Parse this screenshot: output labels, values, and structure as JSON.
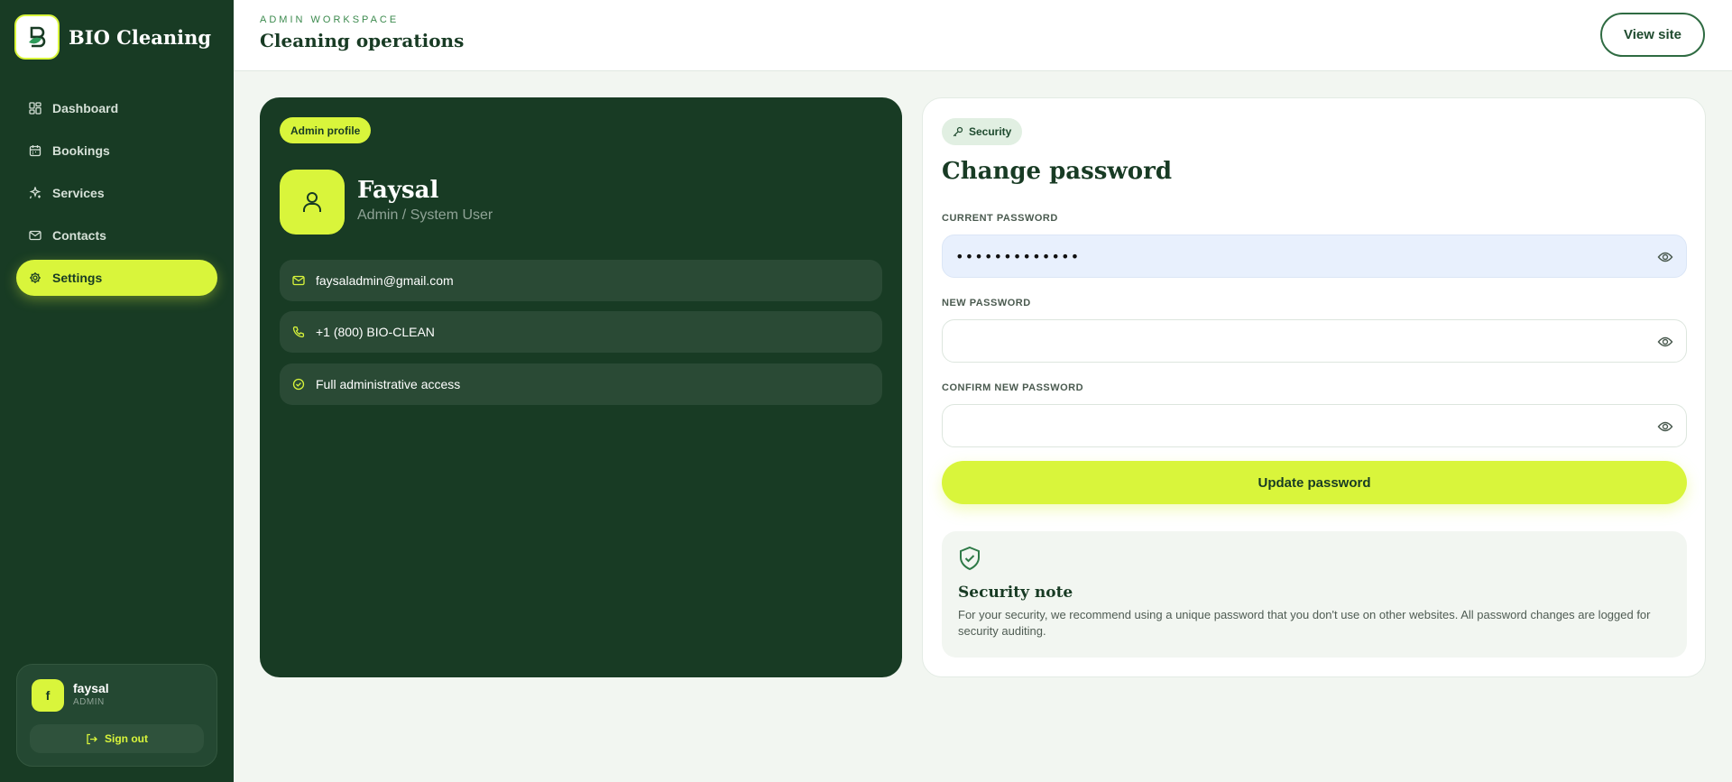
{
  "brand": {
    "name": "BIO Cleaning"
  },
  "sidebar": {
    "items": [
      {
        "label": "Dashboard",
        "icon": "dashboard-icon"
      },
      {
        "label": "Bookings",
        "icon": "calendar-icon"
      },
      {
        "label": "Services",
        "icon": "sparkles-icon"
      },
      {
        "label": "Contacts",
        "icon": "mail-icon"
      },
      {
        "label": "Settings",
        "icon": "gear-icon",
        "active": true
      }
    ],
    "user": {
      "initial": "f",
      "name": "faysal",
      "role": "ADMIN",
      "signout_label": "Sign out"
    }
  },
  "header": {
    "eyebrow": "ADMIN WORKSPACE",
    "title": "Cleaning operations",
    "view_site_label": "View site"
  },
  "profile": {
    "chip": "Admin profile",
    "name": "Faysal",
    "role": "Admin / System User",
    "email": "faysaladmin@gmail.com",
    "phone": "+1 (800) BIO-CLEAN",
    "access": "Full administrative access"
  },
  "security": {
    "chip": "Security",
    "title": "Change password",
    "current_label": "CURRENT PASSWORD",
    "current_value": "•••••••••••••",
    "new_label": "NEW PASSWORD",
    "new_value": "",
    "confirm_label": "CONFIRM NEW PASSWORD",
    "confirm_value": "",
    "button_label": "Update password",
    "note_title": "Security note",
    "note_text": "For your security, we recommend using a unique password that you don't use on other websites. All password changes are logged for security auditing."
  },
  "colors": {
    "sidebar_bg": "#183b24",
    "accent": "#d9f53b",
    "page_bg": "#f2f6f1",
    "field_filled_bg": "#e8f0fd"
  }
}
